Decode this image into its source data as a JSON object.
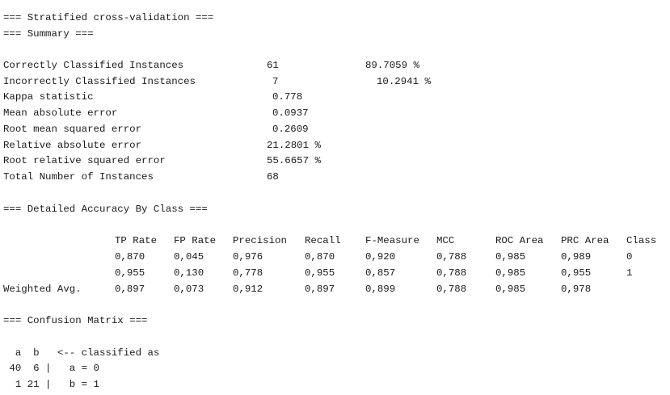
{
  "headers": {
    "stratified": "=== Stratified cross-validation ===",
    "summary": "=== Summary ===",
    "detailed": "=== Detailed Accuracy By Class ===",
    "confusion": "=== Confusion Matrix ==="
  },
  "summary": {
    "correct": {
      "label": "Correctly Classified Instances",
      "value": "61",
      "pct": "89.7059 %"
    },
    "incorrect": {
      "label": "Incorrectly Classified Instances",
      "value": "7",
      "pct": "10.2941 %"
    },
    "kappa": {
      "label": "Kappa statistic",
      "value": "0.778"
    },
    "mae": {
      "label": "Mean absolute error",
      "value": "0.0937"
    },
    "rmse": {
      "label": "Root mean squared error",
      "value": "0.2609"
    },
    "rae": {
      "label": "Relative absolute error",
      "value": "21.2801 %"
    },
    "rrse": {
      "label": "Root relative squared error",
      "value": "55.6657 %"
    },
    "total": {
      "label": "Total Number of Instances",
      "value": "68"
    }
  },
  "accuracy": {
    "columns": [
      "TP Rate",
      "FP Rate",
      "Precision",
      "Recall",
      "F-Measure",
      "MCC",
      "ROC Area",
      "PRC Area",
      "Class"
    ],
    "rows": [
      {
        "label": "",
        "values": [
          "0,870",
          "0,045",
          "0,976",
          "0,870",
          "0,920",
          "0,788",
          "0,985",
          "0,989",
          "0"
        ]
      },
      {
        "label": "",
        "values": [
          "0,955",
          "0,130",
          "0,778",
          "0,955",
          "0,857",
          "0,788",
          "0,985",
          "0,955",
          "1"
        ]
      },
      {
        "label": "Weighted Avg.",
        "values": [
          "0,897",
          "0,073",
          "0,912",
          "0,897",
          "0,899",
          "0,788",
          "0,985",
          "0,978",
          ""
        ]
      }
    ]
  },
  "confusion": {
    "header": "  a  b   <-- classified as",
    "rows": [
      " 40  6 |   a = 0",
      "  1 21 |   b = 1"
    ]
  }
}
